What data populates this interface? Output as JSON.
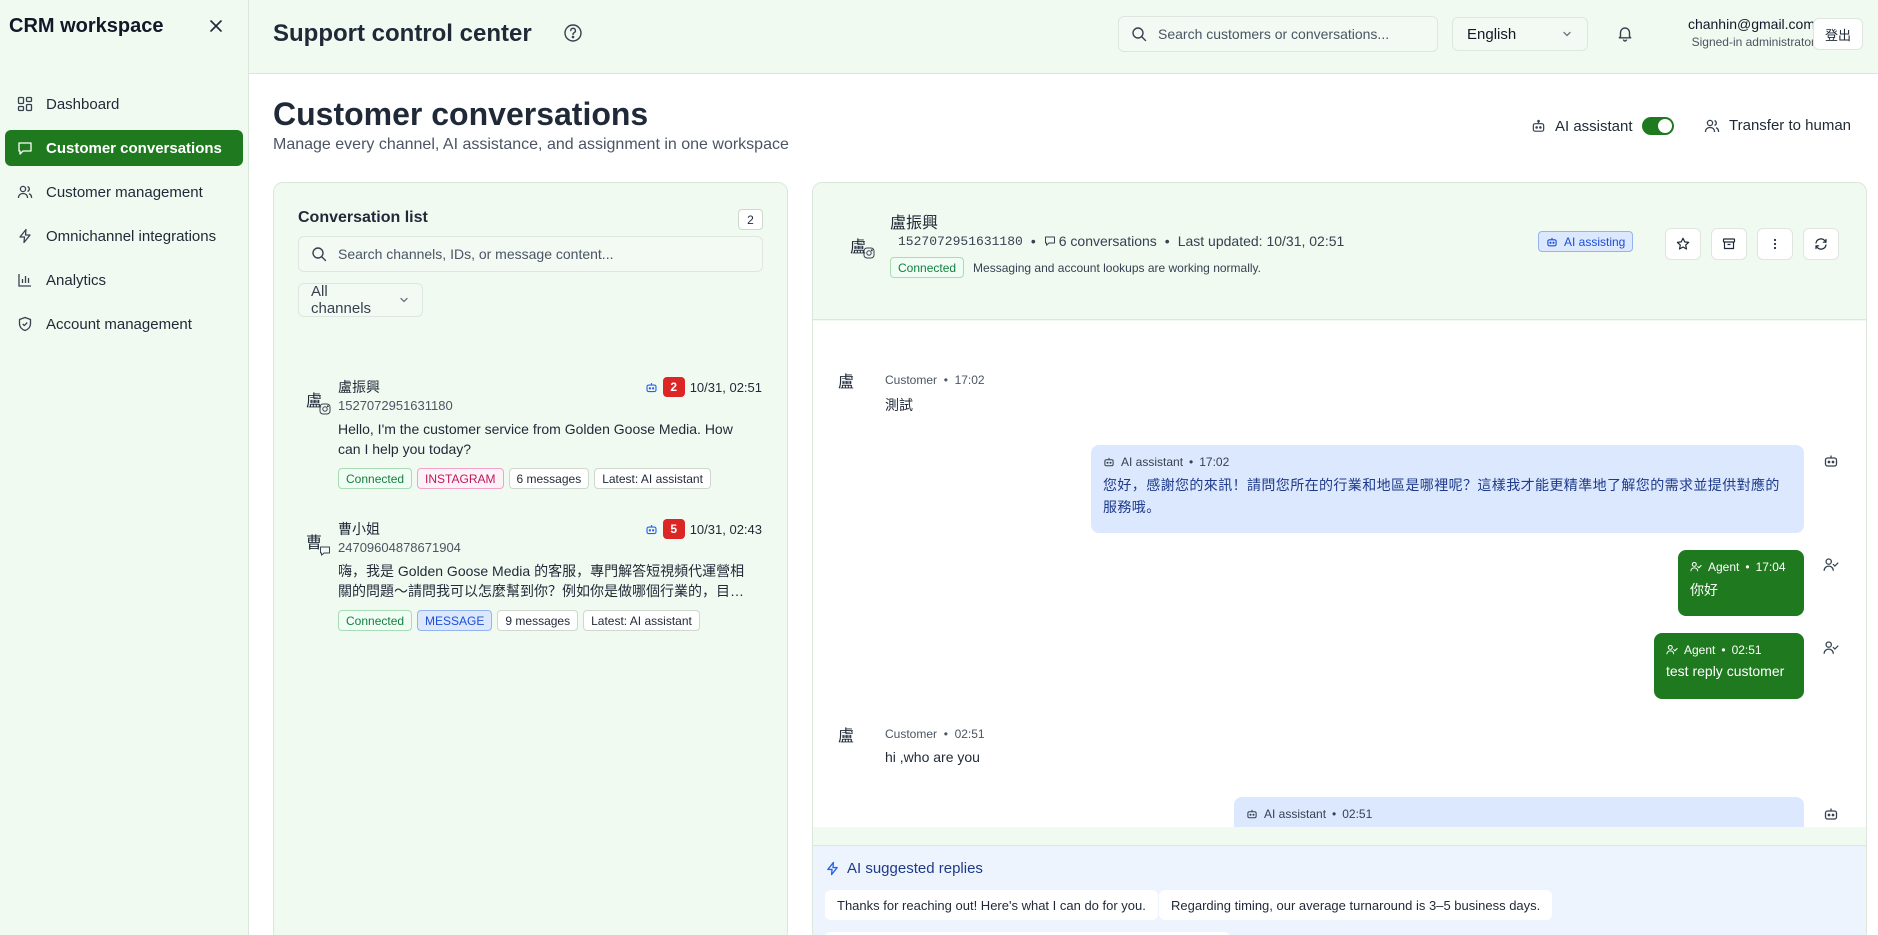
{
  "sidebar": {
    "title": "CRM workspace",
    "items": [
      {
        "label": "Dashboard",
        "icon": "dashboard-icon"
      },
      {
        "label": "Customer conversations",
        "icon": "chat-icon",
        "active": true
      },
      {
        "label": "Customer management",
        "icon": "users-icon"
      },
      {
        "label": "Omnichannel integrations",
        "icon": "bolt-icon"
      },
      {
        "label": "Analytics",
        "icon": "bar-chart-icon"
      },
      {
        "label": "Account management",
        "icon": "shield-icon"
      }
    ]
  },
  "header": {
    "title": "Support control center",
    "search_placeholder": "Search customers or conversations...",
    "language": "English",
    "user_email": "chanhin@gmail.com",
    "user_role": "Signed-in administrator",
    "logout_label": "登出"
  },
  "page": {
    "title": "Customer conversations",
    "subtitle": "Manage every channel, AI assistance, and assignment in one workspace",
    "ai_toggle_label": "AI assistant",
    "ai_toggle_on": true,
    "transfer_label": "Transfer to human"
  },
  "list": {
    "title": "Conversation list",
    "count": "2",
    "search_placeholder": "Search channels, IDs, or message content...",
    "filter": "All channels",
    "conversations": [
      {
        "avatar": "盧",
        "name": "盧振興",
        "id": "1527072951631180",
        "unread": "2",
        "time": "10/31, 02:51",
        "message": "Hello, I'm the customer service from Golden Goose Media. How can I help you today?",
        "status": "Connected",
        "channel": "INSTAGRAM",
        "messages": "6 messages",
        "latest": "Latest: AI assistant"
      },
      {
        "avatar": "曹",
        "name": "曹小姐",
        "id": "24709604878671904",
        "unread": "5",
        "time": "10/31, 02:43",
        "message": "嗨，我是 Golden Goose Media 的客服，專門解答短視頻代運營相關的問題～請問我可以怎麼幫到你？例如你是做哪個行業的，目…",
        "status": "Connected",
        "channel": "MESSAGE",
        "messages": "9 messages",
        "latest": "Latest: AI assistant"
      }
    ]
  },
  "chat": {
    "avatar": "盧",
    "name": "盧振興",
    "id": "1527072951631180",
    "conversations": "6 conversations",
    "last_updated": "Last updated: 10/31, 02:51",
    "status": "Connected",
    "status_text": "Messaging and account lookups are working normally.",
    "ai_badge": "AI assisting",
    "messages": [
      {
        "role": "Customer",
        "time": "17:02",
        "text": "測試"
      },
      {
        "role": "AI assistant",
        "time": "17:02",
        "text": "您好，感謝您的來訊！請問您所在的行業和地區是哪裡呢？這樣我才能更精準地了解您的需求並提供對應的服務哦。"
      },
      {
        "role": "Agent",
        "time": "17:04",
        "text": "你好"
      },
      {
        "role": "Agent",
        "time": "02:51",
        "text": "test reply customer"
      },
      {
        "role": "Customer",
        "time": "02:51",
        "text": "hi ,who are you"
      },
      {
        "role": "AI assistant",
        "time": "02:51",
        "text": ""
      }
    ],
    "suggestions_title": "AI suggested replies",
    "suggestions": [
      "Thanks for reaching out! Here's what I can do for you.",
      "Regarding timing, our average turnaround is 3–5 business days."
    ]
  },
  "colors": {
    "brand_green": "#1f7a1f",
    "background_tint": "#f0faf0",
    "ai_bubble": "#dbe8fd",
    "unread_red": "#dc2626"
  }
}
